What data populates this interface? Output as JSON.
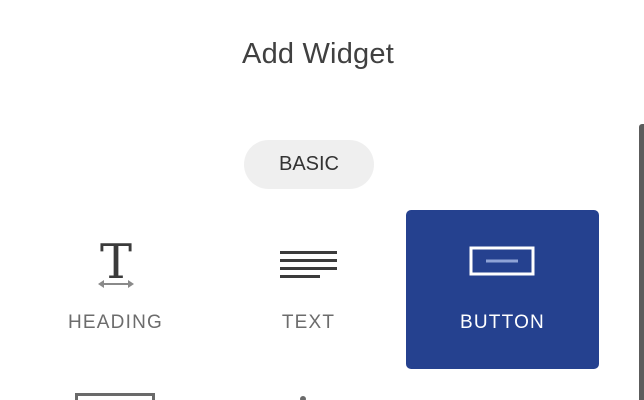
{
  "dialog": {
    "title": "Add Widget",
    "category": "BASIC"
  },
  "widgets": [
    {
      "label": "HEADING",
      "icon": "heading-icon",
      "selected": false
    },
    {
      "label": "TEXT",
      "icon": "text-lines-icon",
      "selected": false
    },
    {
      "label": "BUTTON",
      "icon": "button-icon",
      "selected": true
    }
  ],
  "colors": {
    "accent": "#25418f",
    "pill_background": "#efefef",
    "label_gray": "#6c6c6c",
    "title_gray": "#404040"
  }
}
